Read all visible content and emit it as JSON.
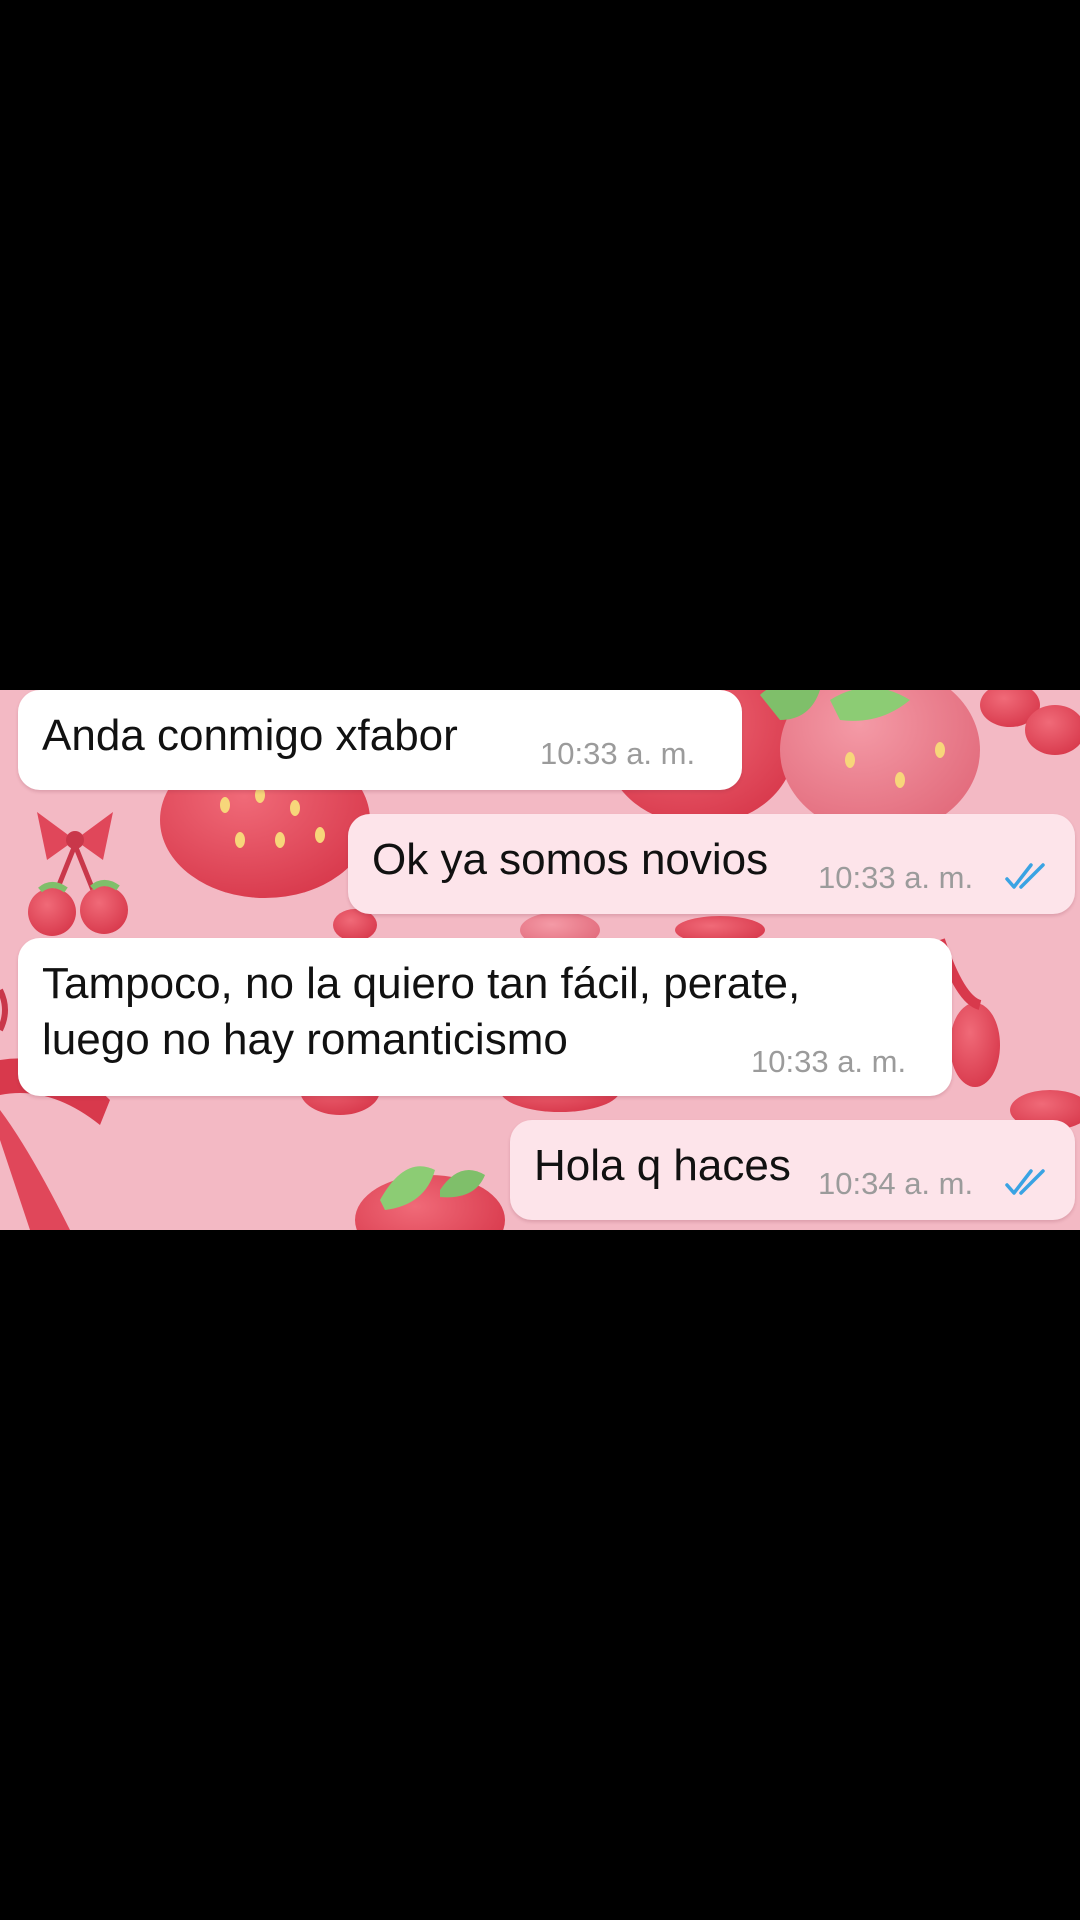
{
  "chat": {
    "colors": {
      "background": "#f3b9c4",
      "incoming_bubble": "#ffffff",
      "outgoing_bubble": "#fde4ea",
      "time_text": "#9b9b9b",
      "read_ticks": "#3aa3e3"
    },
    "messages": [
      {
        "direction": "incoming",
        "lines": [
          "Anda conmigo xfabor"
        ],
        "time": "10:33 a. m."
      },
      {
        "direction": "outgoing",
        "lines": [
          "Ok ya somos novios"
        ],
        "time": "10:33 a. m.",
        "status_icon": "double-check-read-icon"
      },
      {
        "direction": "incoming",
        "lines": [
          "Tampoco, no la quiero tan fácil, perate,",
          "luego no hay romanticismo"
        ],
        "time": "10:33 a. m."
      },
      {
        "direction": "outgoing",
        "lines": [
          "Hola q haces"
        ],
        "time": "10:34 a. m.",
        "status_icon": "double-check-read-icon"
      }
    ]
  }
}
